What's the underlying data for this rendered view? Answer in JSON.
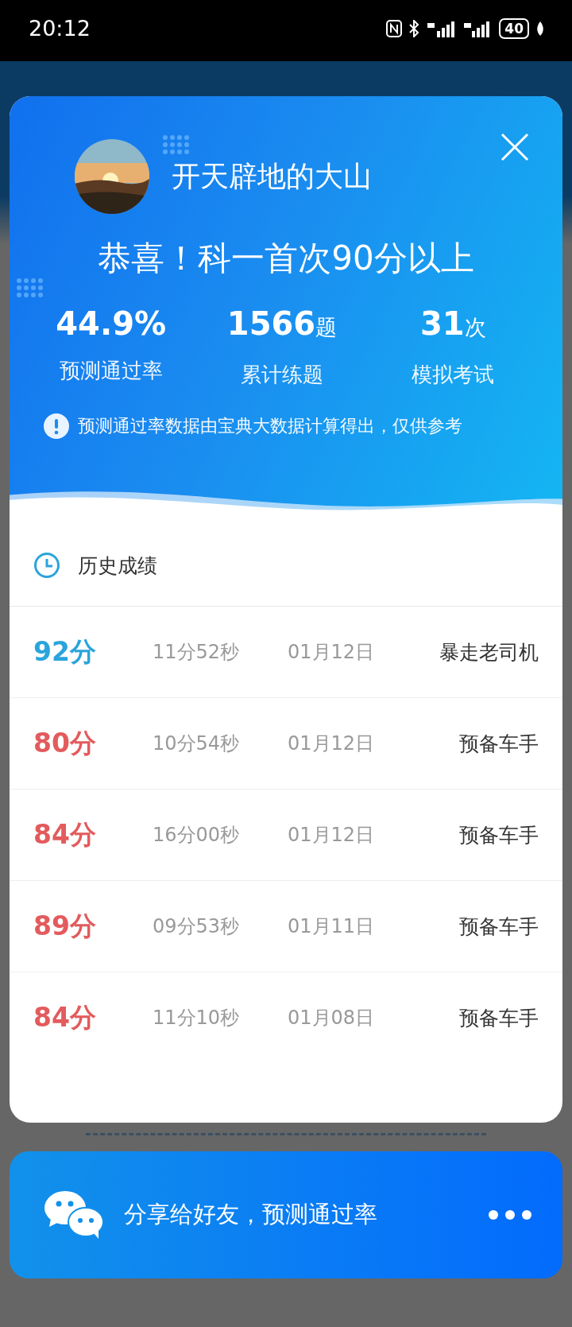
{
  "status_bar": {
    "time": "20:12",
    "battery": "40"
  },
  "profile": {
    "name": "开天辟地的大山"
  },
  "headline": "恭喜！科一首次90分以上",
  "stats": [
    {
      "value": "44.9%",
      "label": "预测通过率"
    },
    {
      "value": "1566",
      "unit": "题",
      "label": "累计练题"
    },
    {
      "value": "31",
      "unit": "次",
      "label": "模拟考试"
    }
  ],
  "note": "预测通过率数据由宝典大数据计算得出，仅供参考",
  "history": {
    "title": "历史成绩",
    "rows": [
      {
        "score": "92分",
        "color": "#2aa4dc",
        "duration": "11分52秒",
        "date": "01月12日",
        "rank": "暴走老司机"
      },
      {
        "score": "80分",
        "color": "#e35b5d",
        "duration": "10分54秒",
        "date": "01月12日",
        "rank": "预备车手"
      },
      {
        "score": "84分",
        "color": "#e35b5d",
        "duration": "16分00秒",
        "date": "01月12日",
        "rank": "预备车手"
      },
      {
        "score": "89分",
        "color": "#e35b5d",
        "duration": "09分53秒",
        "date": "01月11日",
        "rank": "预备车手"
      },
      {
        "score": "84分",
        "color": "#e35b5d",
        "duration": "11分10秒",
        "date": "01月08日",
        "rank": "预备车手"
      }
    ]
  },
  "share": {
    "label": "分享给好友，预测通过率"
  }
}
